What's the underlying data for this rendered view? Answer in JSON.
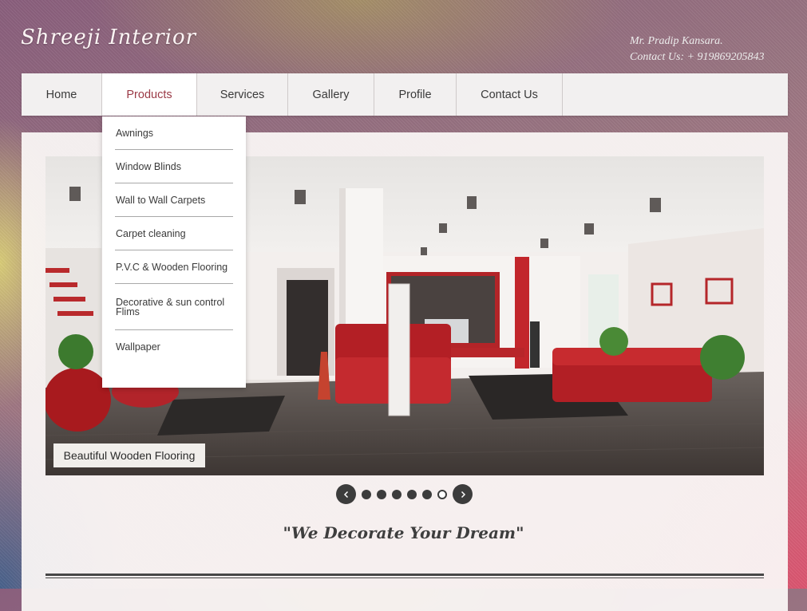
{
  "brand": {
    "logo_text": "Shreeji Interior"
  },
  "header_contact": {
    "name": "Mr. Pradip Kansara.",
    "phone": "Contact Us: + 919869205843"
  },
  "nav": {
    "items": [
      {
        "label": "Home"
      },
      {
        "label": "Products",
        "active": true
      },
      {
        "label": "Services"
      },
      {
        "label": "Gallery"
      },
      {
        "label": "Profile"
      },
      {
        "label": "Contact Us"
      }
    ]
  },
  "products_menu": {
    "items": [
      {
        "label": "Awnings"
      },
      {
        "label": "Window Blinds"
      },
      {
        "label": "Wall to Wall Carpets"
      },
      {
        "label": "Carpet cleaning"
      },
      {
        "label": "P.V.C & Wooden Flooring"
      },
      {
        "label": "Decorative & sun control Flims"
      },
      {
        "label": "Wallpaper"
      }
    ]
  },
  "slider": {
    "caption": "Beautiful Wooden Flooring",
    "slide_count": 6,
    "current_slide": 6
  },
  "tagline": "\"We Decorate Your Dream\"",
  "colors": {
    "accent": "#9b3a46",
    "dark": "#3c3c3c",
    "sofa_red": "#b82226"
  }
}
